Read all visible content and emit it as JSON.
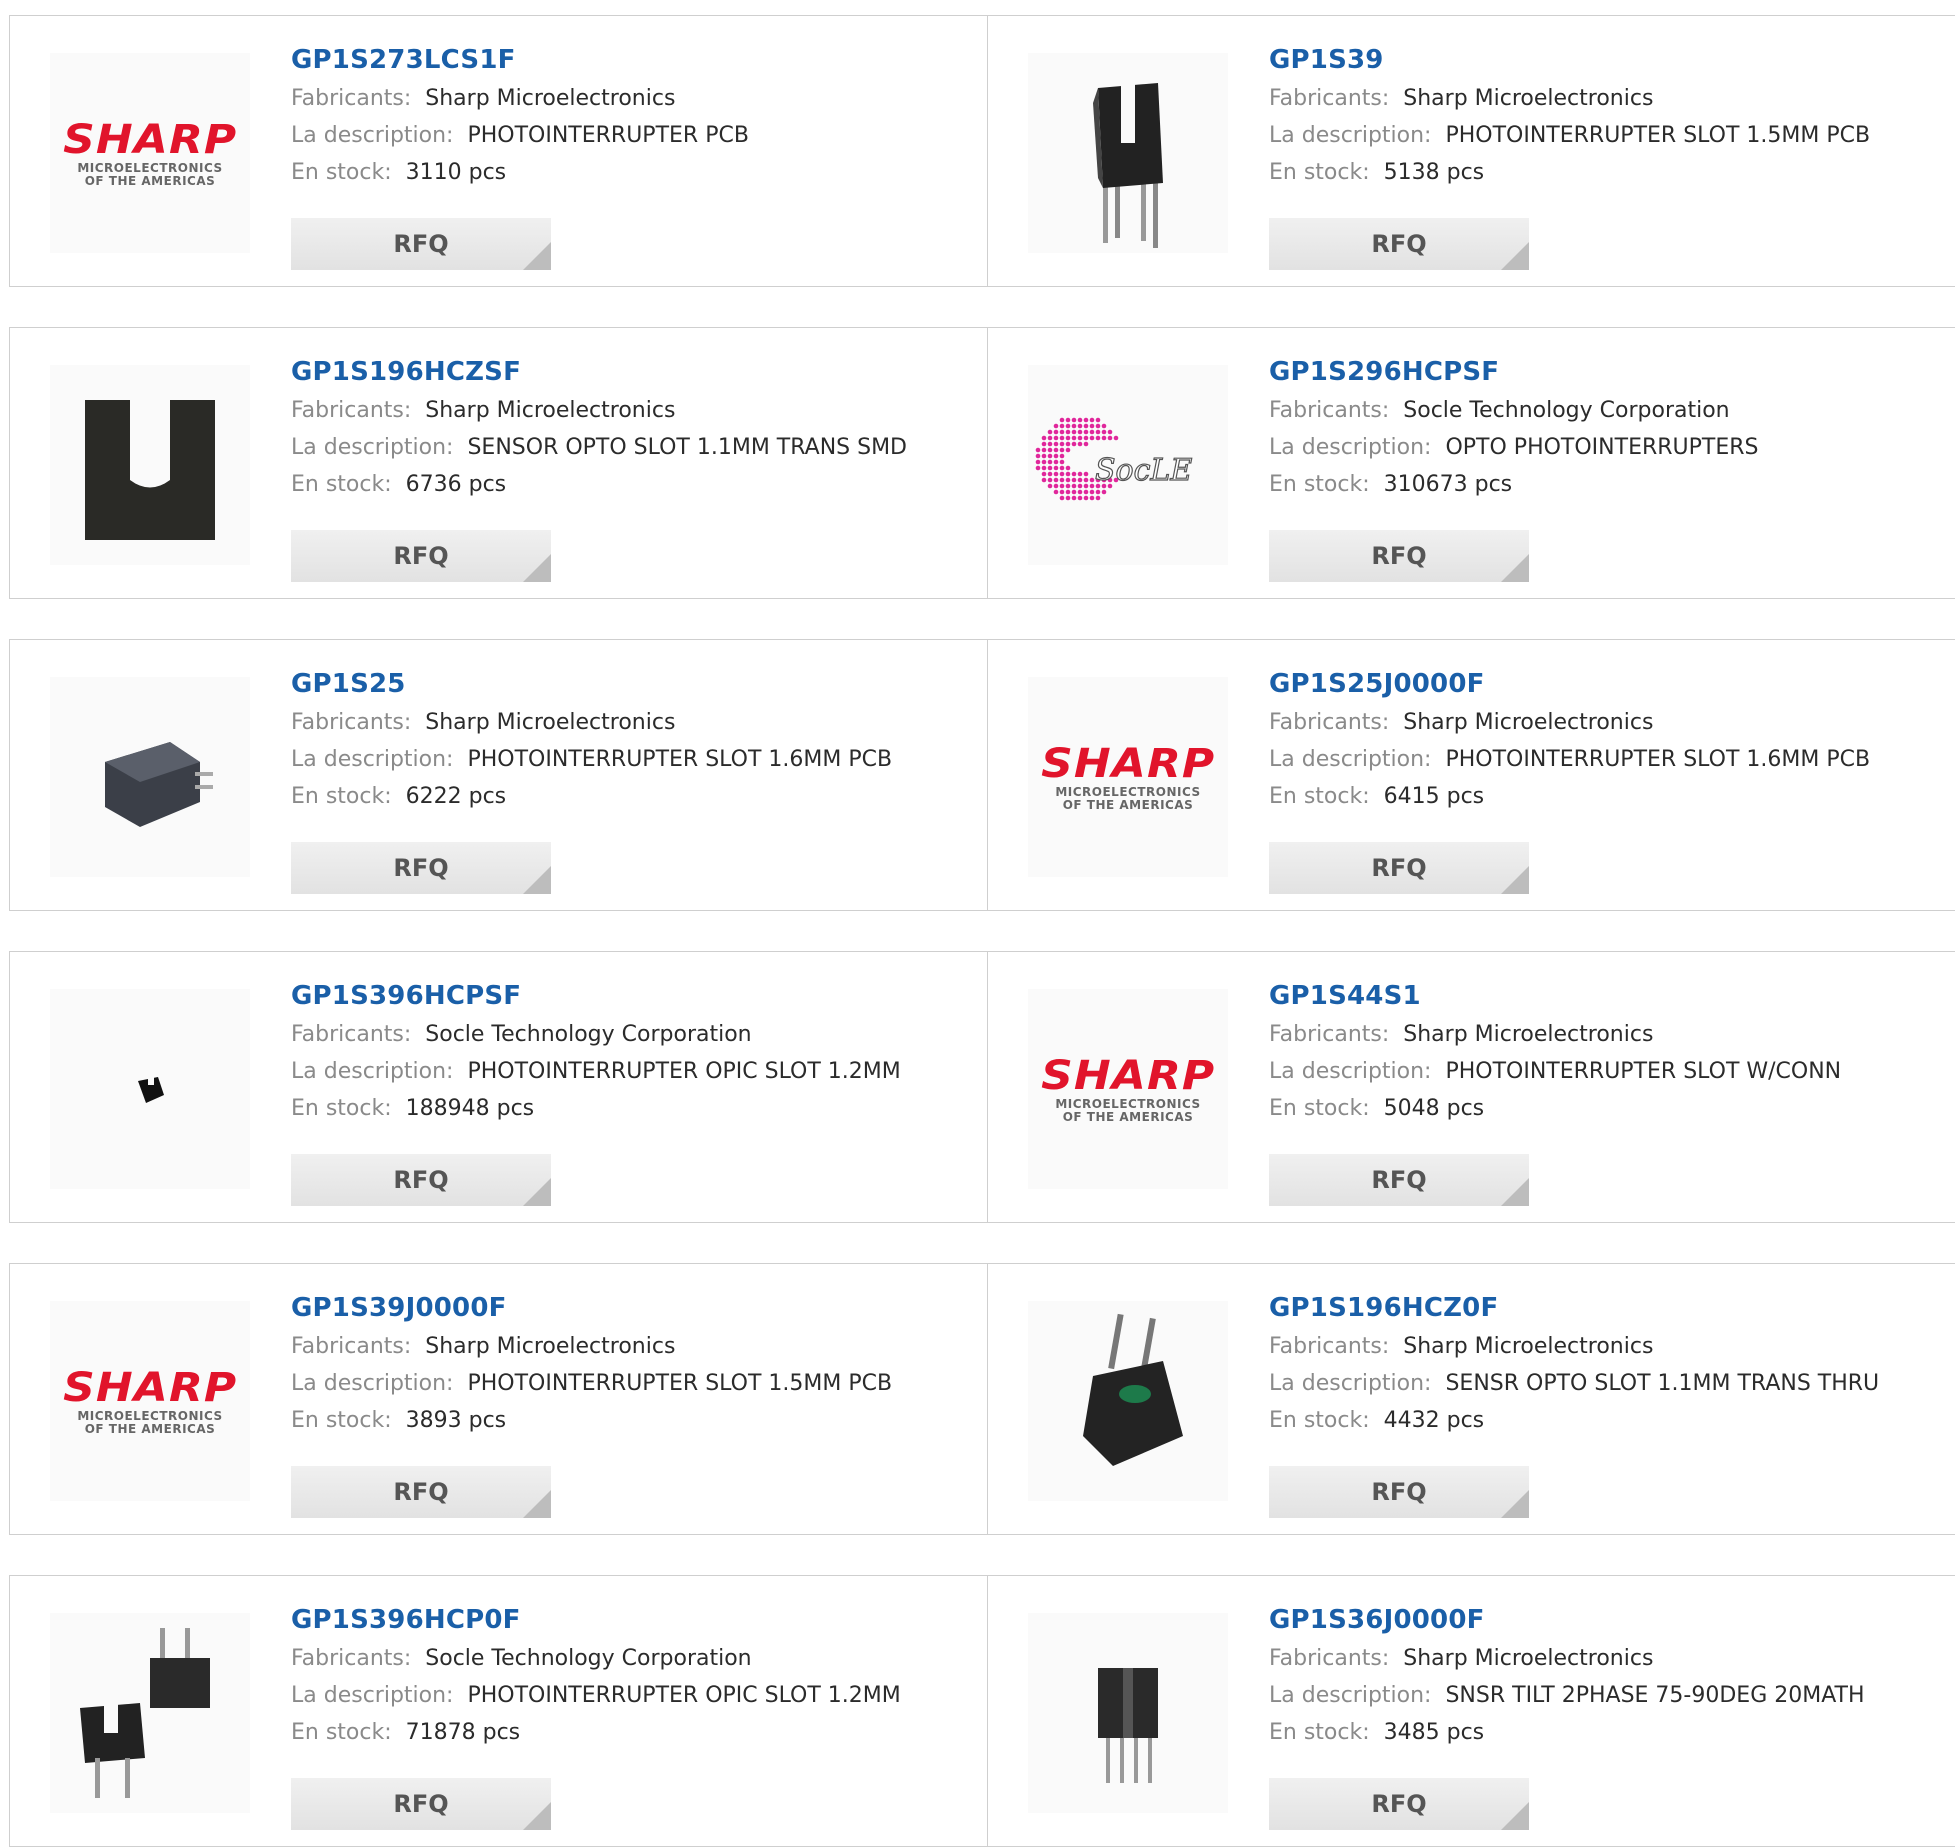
{
  "labels": {
    "manufacturer": "Fabricants:",
    "description": "La description:",
    "stock": "En stock:",
    "rfq": "RFQ"
  },
  "logos": {
    "sharp_main": "SHARP",
    "sharp_sub1": "MICROELECTRONICS",
    "sharp_sub2": "OF THE AMERICAS",
    "socle_text": "SocLE",
    "sharp_color": "#e1142b",
    "socle_color": "#e0279b"
  },
  "colors": {
    "part_link": "#1a5fa8",
    "label": "#8a8a8a",
    "value": "#2b2b2b"
  },
  "products": [
    {
      "part": "GP1S273LCS1F",
      "manufacturer": "Sharp Microelectronics",
      "description": "PHOTOINTERRUPTER PCB",
      "stock": "3110 pcs",
      "image": "sharp-logo"
    },
    {
      "part": "GP1S39",
      "manufacturer": "Sharp Microelectronics",
      "description": "PHOTOINTERRUPTER SLOT 1.5MM PCB",
      "stock": "5138 pcs",
      "image": "slot-sensor-pins"
    },
    {
      "part": "GP1S196HCZSF",
      "manufacturer": "Sharp Microelectronics",
      "description": "SENSOR OPTO SLOT 1.1MM TRANS SMD",
      "stock": "6736 pcs",
      "image": "u-shape-sensor"
    },
    {
      "part": "GP1S296HCPSF",
      "manufacturer": "Socle Technology Corporation",
      "description": "OPTO PHOTOINTERRUPTERS",
      "stock": "310673 pcs",
      "image": "socle-logo"
    },
    {
      "part": "GP1S25",
      "manufacturer": "Sharp Microelectronics",
      "description": "PHOTOINTERRUPTER SLOT 1.6MM PCB",
      "stock": "6222 pcs",
      "image": "small-sensor-block"
    },
    {
      "part": "GP1S25J0000F",
      "manufacturer": "Sharp Microelectronics",
      "description": "PHOTOINTERRUPTER SLOT 1.6MM PCB",
      "stock": "6415 pcs",
      "image": "sharp-logo"
    },
    {
      "part": "GP1S396HCPSF",
      "manufacturer": "Socle Technology Corporation",
      "description": "PHOTOINTERRUPTER OPIC SLOT 1.2MM",
      "stock": "188948 pcs",
      "image": "tiny-sensor"
    },
    {
      "part": "GP1S44S1",
      "manufacturer": "Sharp Microelectronics",
      "description": "PHOTOINTERRUPTER SLOT W/CONN",
      "stock": "5048 pcs",
      "image": "sharp-logo"
    },
    {
      "part": "GP1S39J0000F",
      "manufacturer": "Sharp Microelectronics",
      "description": "PHOTOINTERRUPTER SLOT 1.5MM PCB",
      "stock": "3893 pcs",
      "image": "sharp-logo"
    },
    {
      "part": "GP1S196HCZ0F",
      "manufacturer": "Sharp Microelectronics",
      "description": "SENSR OPTO SLOT 1.1MM TRANS THRU",
      "stock": "4432 pcs",
      "image": "green-window-sensor"
    },
    {
      "part": "GP1S396HCP0F",
      "manufacturer": "Socle Technology Corporation",
      "description": "PHOTOINTERRUPTER OPIC SLOT 1.2MM",
      "stock": "71878 pcs",
      "image": "two-sensors"
    },
    {
      "part": "GP1S36J0000F",
      "manufacturer": "Sharp Microelectronics",
      "description": "SNSR TILT 2PHASE 75-90DEG 20MATH",
      "stock": "3485 pcs",
      "image": "cube-sensor-pins"
    }
  ]
}
